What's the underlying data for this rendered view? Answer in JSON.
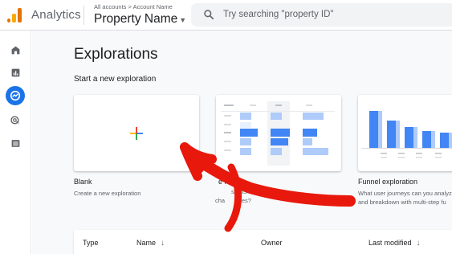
{
  "app": {
    "name": "Analytics"
  },
  "header": {
    "breadcrumb": "All accounts > Account Name",
    "property_name": "Property Name",
    "search_placeholder": "Try searching \"property ID\""
  },
  "nav": {
    "items": [
      {
        "name": "home-icon",
        "active": false
      },
      {
        "name": "reports-icon",
        "active": false
      },
      {
        "name": "explore-icon",
        "active": true
      },
      {
        "name": "advertising-icon",
        "active": false
      },
      {
        "name": "configure-icon",
        "active": false
      }
    ]
  },
  "page": {
    "title": "Explorations",
    "subtitle": "Start a new exploration"
  },
  "templates": {
    "blank": {
      "label": "Blank",
      "description": "Create a new exploration"
    },
    "freeform": {
      "label_partial": "e form",
      "description_line1": "sights can you",
      "description_line2": "cha",
      "description_line2b": "bles?"
    },
    "funnel": {
      "label": "Funnel exploration",
      "description_line1": "What user journeys can you analyz",
      "description_line2": "and breakdown with multi-step fu"
    }
  },
  "table": {
    "columns": [
      "Type",
      "Name",
      "Owner",
      "Last modified"
    ]
  },
  "colors": {
    "accent": "#1a73e8",
    "annotation_arrow": "#e8180c",
    "logo_orange": "#e37400",
    "logo_yellow": "#f9ab00"
  }
}
